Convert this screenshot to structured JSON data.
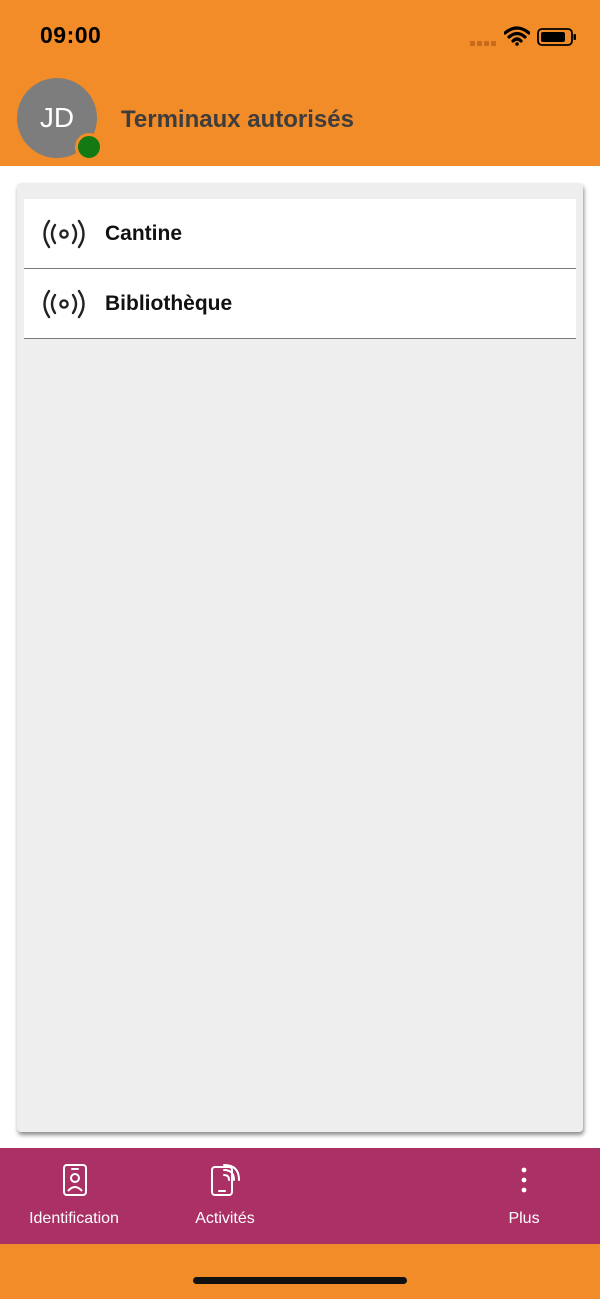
{
  "status_bar": {
    "time": "09:00",
    "icons": [
      "cellular-signal-icon",
      "wifi-icon",
      "battery-icon"
    ]
  },
  "header": {
    "avatar_initials": "JD",
    "presence_status": "online",
    "title": "Terminaux autorisés"
  },
  "terminals": [
    {
      "label": "Cantine",
      "icon": "broadcast-icon"
    },
    {
      "label": "Bibliothèque",
      "icon": "broadcast-icon"
    }
  ],
  "tab_bar": {
    "tabs": [
      {
        "label": "Identification",
        "icon": "id-badge-icon"
      },
      {
        "label": "Activités",
        "icon": "phone-nfc-icon"
      },
      {
        "label": "Plus",
        "icon": "more-vertical-icon"
      }
    ]
  },
  "colors": {
    "primary": "#F28C28",
    "tab_bar": "#AB3065",
    "avatar": "#7D7D7D",
    "presence": "#137A13",
    "card_background": "#EEEEEE"
  }
}
